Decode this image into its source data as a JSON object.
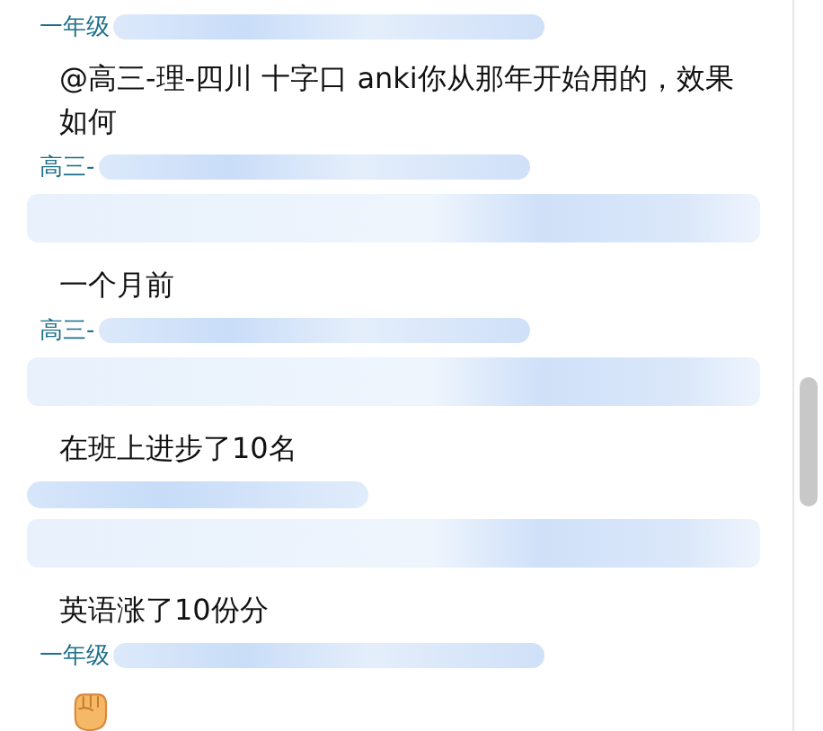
{
  "chat": {
    "items": [
      {
        "kind": "sender",
        "name": "一年级"
      },
      {
        "kind": "text",
        "text": "@高三-理-四川 十字口 anki你从那年开始用的，效果如何"
      },
      {
        "kind": "sender",
        "name": "高三-"
      },
      {
        "kind": "redacted"
      },
      {
        "kind": "text",
        "text": "一个月前"
      },
      {
        "kind": "sender",
        "name": "高三-"
      },
      {
        "kind": "redacted"
      },
      {
        "kind": "text",
        "text": "在班上进步了10名"
      },
      {
        "kind": "redacted-name"
      },
      {
        "kind": "redacted"
      },
      {
        "kind": "text",
        "text": "英语涨了10份分"
      },
      {
        "kind": "sender",
        "name": "一年级"
      },
      {
        "kind": "emoji"
      }
    ]
  }
}
